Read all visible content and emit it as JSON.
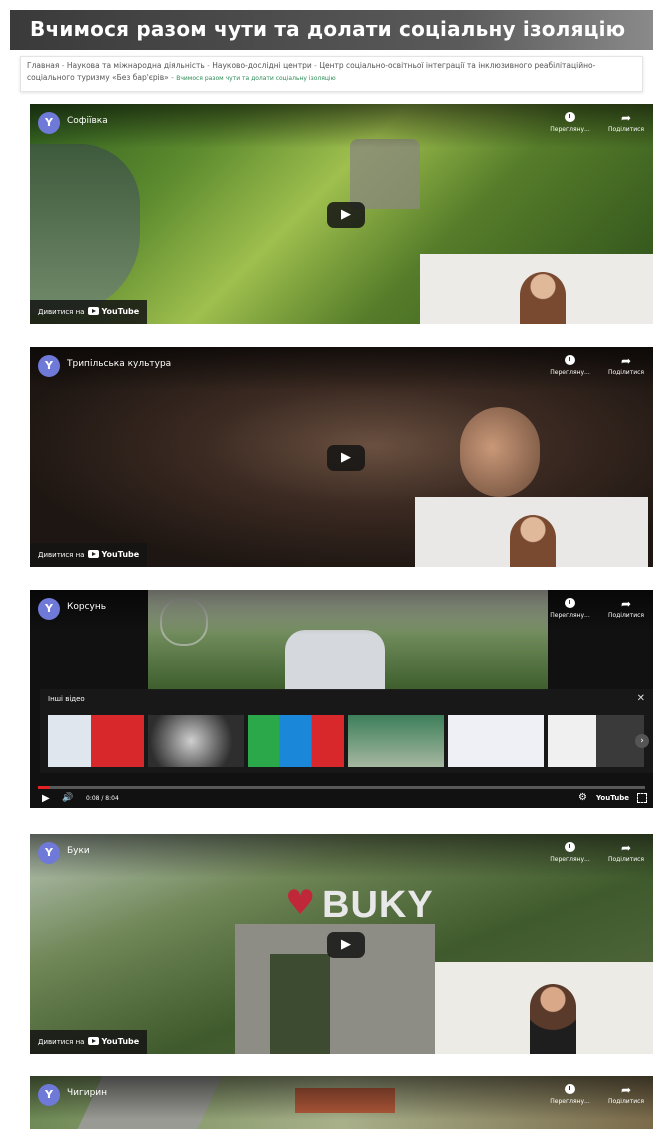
{
  "page": {
    "title": "Вчимося разом чути та долати соціальну ізоляцію"
  },
  "breadcrumb": {
    "items": [
      "Главная",
      "Наукова та міжнародна діяльність",
      "Науково-дослідні центри",
      "Центр соціально-освітньої інтеграції та інклюзивного реабілітаційно-соціального туризму «Без бар'єрів»"
    ],
    "separator": " - ",
    "current": "Вчимося разом чути та долати соціальну ізоляцію"
  },
  "player": {
    "avatar_letter": "Y",
    "watch_later_label": "Перегляну...",
    "share_label": "Поділитися",
    "watch_on_label": "Дивитися на",
    "youtube_label": "YouTube"
  },
  "videos": [
    {
      "title": "Софіївка"
    },
    {
      "title": "Трипільська культура"
    },
    {
      "title": "Корсунь",
      "related_title": "Інші відео",
      "time": "0:08 / 8:04",
      "watermark": "",
      "progress": 0.02
    },
    {
      "title": "Буки",
      "sign": "BUKY"
    },
    {
      "title": "Чигирин"
    }
  ],
  "colors": {
    "progress": "#e52222",
    "breadcrumb_current": "#2e8b57",
    "avatar": "#6f79d8"
  }
}
